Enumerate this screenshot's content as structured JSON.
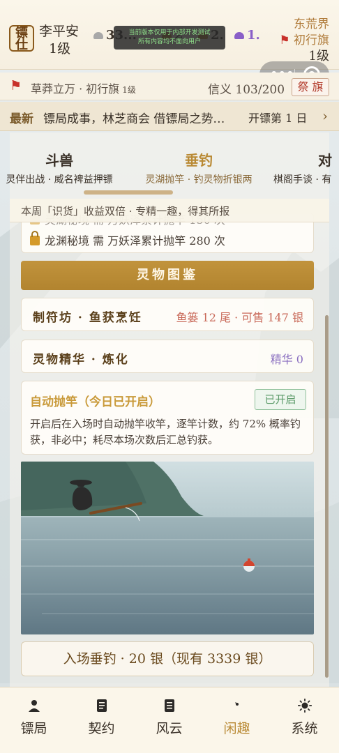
{
  "topbar": {
    "avatar_text": "镖\n仕",
    "player_name": "李平安",
    "player_level": "1级",
    "resources": [
      {
        "icon": "silver-ingot-icon",
        "value": "33...",
        "color": "#9a9a9a"
      },
      {
        "icon": "gem-icon",
        "value": "2",
        "color": "#b98a35"
      },
      {
        "icon": "cloud-icon",
        "value": "2.",
        "color": "#b98a35"
      },
      {
        "icon": "purple-cloud-icon",
        "value": "1.",
        "color": "#8a5fc8"
      }
    ],
    "dev_notice_line1": "当前版本仅用于内部开发测试",
    "dev_notice_line2": "所有内容均不面向用户",
    "region": "东荒界",
    "flag_rank": "初行旗",
    "region_level": "1级"
  },
  "banner": {
    "title": "草莽立万 · 初行旗",
    "title_level": "1级",
    "trust": "信义 103/200",
    "button": "祭 旗"
  },
  "ticker": {
    "label": "最新",
    "text": "镖局成事，林芝商会 借镖局之势…",
    "day_text": "开镖第  1  日"
  },
  "tabs": [
    {
      "name": "斗兽",
      "sub": "灵伴出战 · 威名裨益押镖"
    },
    {
      "name": "垂钓",
      "sub": "灵湖抛竿 · 钓灵物折银两"
    },
    {
      "name": "对",
      "sub": "棋阁手谈 · 有"
    }
  ],
  "notice": "本周「识货」收益双倍 · 专精一趣，得其所报",
  "locks": [
    {
      "text": "灵湖秘境 需 万妖泽累计抛竿 150 次"
    },
    {
      "text": "龙渊秘境 需 万妖泽累计抛竿 280 次"
    }
  ],
  "codex_button": "灵物图鉴",
  "workshop": {
    "title": "制符坊 · 鱼获烹饪",
    "value": "鱼篓 12 尾 · 可售 147 银",
    "color": "#c96a5a"
  },
  "essence": {
    "title": "灵物精华 · 炼化",
    "value": "精华 0",
    "color": "#8a6fc0"
  },
  "auto_cast": {
    "title": "自动抛竿（今日已开启）",
    "badge": "已开启",
    "desc": "开启后在入场时自动抛竿收竿，逐竿计数，约 72% 概率钓获，非必中；耗尽本场次数后汇总钓获。"
  },
  "enter_button": "入场垂钓 · 20 银（现有 3339 银）",
  "nav": [
    {
      "label": "镖局",
      "icon": "person-icon",
      "active": false
    },
    {
      "label": "契约",
      "icon": "document-icon",
      "active": false
    },
    {
      "label": "风云",
      "icon": "scroll-icon",
      "active": false
    },
    {
      "label": "闲趣",
      "icon": "moon-icon",
      "active": true
    },
    {
      "label": "系统",
      "icon": "sun-icon",
      "active": false
    }
  ]
}
